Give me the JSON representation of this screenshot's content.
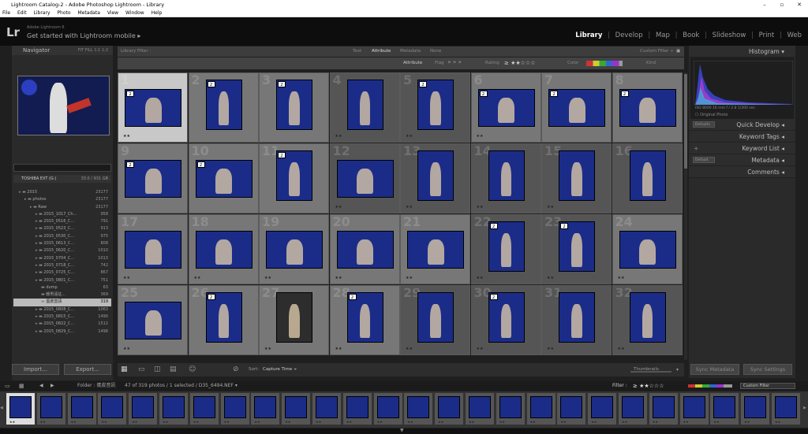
{
  "window": {
    "title": "Lightroom Catalog-2 - Adobe Photoshop Lightroom - Library"
  },
  "menu": [
    "File",
    "Edit",
    "Library",
    "Photo",
    "Metadata",
    "View",
    "Window",
    "Help"
  ],
  "identity": {
    "logo": "Lr",
    "sub": "Adobe Lightroom 6",
    "main": "Get started with Lightroom mobile ▸"
  },
  "modules": [
    "Library",
    "Develop",
    "Map",
    "Book",
    "Slideshow",
    "Print",
    "Web"
  ],
  "navigator": {
    "title": "Navigator",
    "zoom": [
      "FIT",
      "FILL",
      "1:1",
      "1:2"
    ]
  },
  "folders": {
    "volume": "TOSHIBA EXT (G:)",
    "volume_count": "33.0 / 931 GB",
    "items": [
      {
        "name": "2015",
        "count": "23177",
        "level": 1
      },
      {
        "name": "photos",
        "count": "23177",
        "level": 2
      },
      {
        "name": "Raw",
        "count": "23177",
        "level": 3
      },
      {
        "name": "2015_1017_Ch...",
        "count": "958",
        "level": 4
      },
      {
        "name": "2015_0516_C...",
        "count": "791",
        "level": 4
      },
      {
        "name": "2015_0523_C...",
        "count": "913",
        "level": 4
      },
      {
        "name": "2015_0530_C...",
        "count": "975",
        "level": 4
      },
      {
        "name": "2015_0613_C...",
        "count": "808",
        "level": 4
      },
      {
        "name": "2015_0620_C...",
        "count": "1010",
        "level": 4
      },
      {
        "name": "2015_0704_C...",
        "count": "1013",
        "level": 4
      },
      {
        "name": "2015_0718_C...",
        "count": "742",
        "level": 4
      },
      {
        "name": "2015_0725_C...",
        "count": "867",
        "level": 4
      },
      {
        "name": "2015_0801_C...",
        "count": "751",
        "level": 4
      },
      {
        "name": "dump",
        "count": "63",
        "level": 5
      },
      {
        "name": "暖男遠征...",
        "count": "369",
        "level": 5
      },
      {
        "name": "蛋皮音訊",
        "count": "319",
        "level": 5,
        "selected": true
      },
      {
        "name": "2015_0808_C...",
        "count": "1063",
        "level": 4
      },
      {
        "name": "2015_0815_C...",
        "count": "1490",
        "level": 4
      },
      {
        "name": "2015_0822_C...",
        "count": "1512",
        "level": 4
      },
      {
        "name": "2015_0829_C...",
        "count": "1498",
        "level": 4
      }
    ]
  },
  "buttons": {
    "import": "Import...",
    "export": "Export..."
  },
  "library_filter": {
    "label": "Library Filter :",
    "tabs": [
      "Text",
      "Attribute",
      "Metadata",
      "None"
    ],
    "custom": "Custom Filter ÷"
  },
  "attribute_bar": {
    "label": "Attribute",
    "flag": "Flag",
    "rating": "Rating",
    "color": "Color",
    "kind": "Kind"
  },
  "grid": {
    "cells": [
      {
        "num": "1",
        "badge": "2",
        "stars": "★★",
        "sel": true
      },
      {
        "num": "2",
        "badge": "2",
        "stars": ""
      },
      {
        "num": "3",
        "badge": "2",
        "stars": ""
      },
      {
        "num": "4",
        "badge": "",
        "stars": "★★"
      },
      {
        "num": "5",
        "badge": "2",
        "stars": "★★"
      },
      {
        "num": "6",
        "badge": "2",
        "stars": "★★"
      },
      {
        "num": "7",
        "badge": "2",
        "stars": ""
      },
      {
        "num": "8",
        "badge": "2",
        "stars": ""
      },
      {
        "num": "9",
        "badge": "2",
        "stars": ""
      },
      {
        "num": "10",
        "badge": "2",
        "stars": ""
      },
      {
        "num": "11",
        "badge": "2",
        "stars": ""
      },
      {
        "num": "12",
        "badge": "",
        "stars": "★★"
      },
      {
        "num": "13",
        "badge": "",
        "stars": "★★"
      },
      {
        "num": "14",
        "badge": "",
        "stars": "★★"
      },
      {
        "num": "15",
        "badge": "",
        "stars": "★★"
      },
      {
        "num": "16",
        "badge": "",
        "stars": ""
      },
      {
        "num": "17",
        "badge": "",
        "stars": "★★"
      },
      {
        "num": "18",
        "badge": "",
        "stars": "★★"
      },
      {
        "num": "19",
        "badge": "",
        "stars": "★★"
      },
      {
        "num": "20",
        "badge": "",
        "stars": "★★"
      },
      {
        "num": "21",
        "badge": "",
        "stars": "★★"
      },
      {
        "num": "22",
        "badge": "2",
        "stars": "★★"
      },
      {
        "num": "23",
        "badge": "2",
        "stars": "★★"
      },
      {
        "num": "24",
        "badge": "",
        "stars": "★★"
      },
      {
        "num": "25",
        "badge": "",
        "stars": "★★"
      },
      {
        "num": "26",
        "badge": "2",
        "stars": ""
      },
      {
        "num": "27",
        "badge": "",
        "stars": "★★"
      },
      {
        "num": "28",
        "badge": "2",
        "stars": "★★"
      },
      {
        "num": "29",
        "badge": "",
        "stars": "★★"
      },
      {
        "num": "30",
        "badge": "2",
        "stars": "★★"
      },
      {
        "num": "31",
        "badge": "",
        "stars": "★★"
      },
      {
        "num": "32",
        "badge": "",
        "stars": "★★"
      }
    ]
  },
  "toolbar": {
    "sort_label": "Sort:",
    "sort_value": "Capture Time ÷",
    "thumbnails": "Thumbnails"
  },
  "right": {
    "histogram": "Histogram",
    "histo_info": "ISO 8000    16 mm    f / 2.8    1/200 sec",
    "original": "Original Photo",
    "panels": [
      {
        "label": "Quick Develop",
        "preset": "Defaults"
      },
      {
        "label": "Keyword Tags"
      },
      {
        "label": "Keyword List"
      },
      {
        "label": "Metadata",
        "preset": "Default"
      },
      {
        "label": "Comments"
      }
    ],
    "sync_metadata": "Sync Metadata",
    "sync_settings": "Sync Settings"
  },
  "strip": {
    "folder": "Folder : 蛋皮音訊",
    "info": "47 of 319 photos / 1 selected / D35_6494.NEF ▾",
    "filter": "Filter :",
    "custom": "Custom Filter"
  },
  "filmstrip": {
    "stars": "★★"
  }
}
